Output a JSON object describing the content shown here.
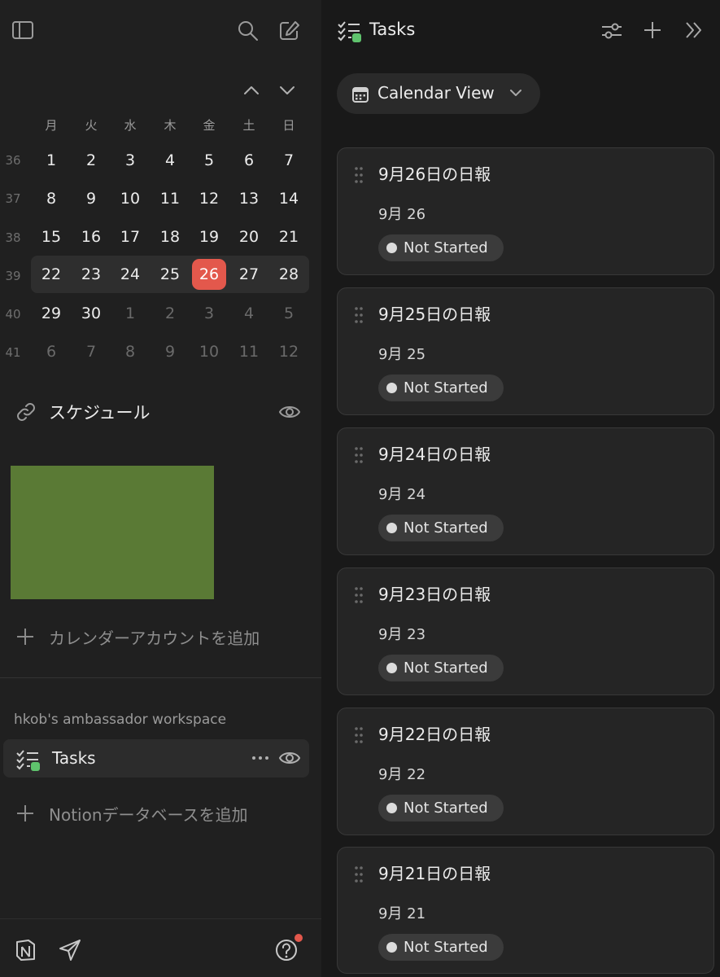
{
  "calendar": {
    "weekdays": [
      "月",
      "火",
      "水",
      "木",
      "金",
      "土",
      "日"
    ],
    "weeks": [
      {
        "num": "36",
        "days": [
          "1",
          "2",
          "3",
          "4",
          "5",
          "6",
          "7"
        ]
      },
      {
        "num": "37",
        "days": [
          "8",
          "9",
          "10",
          "11",
          "12",
          "13",
          "14"
        ]
      },
      {
        "num": "38",
        "days": [
          "15",
          "16",
          "17",
          "18",
          "19",
          "20",
          "21"
        ]
      },
      {
        "num": "39",
        "days": [
          "22",
          "23",
          "24",
          "25",
          "26",
          "27",
          "28"
        ]
      },
      {
        "num": "40",
        "days": [
          "29",
          "30",
          "1",
          "2",
          "3",
          "4",
          "5"
        ]
      },
      {
        "num": "41",
        "days": [
          "6",
          "7",
          "8",
          "9",
          "10",
          "11",
          "12"
        ]
      }
    ],
    "today": "26"
  },
  "schedule": {
    "title": "スケジュール",
    "swatch_color": "#5a7a35",
    "add_calendar_label": "カレンダーアカウントを追加"
  },
  "workspace": {
    "name": "hkob's ambassador workspace",
    "db_item_label": "Tasks",
    "add_db_label": "Notionデータベースを追加"
  },
  "header": {
    "title": "Tasks",
    "view_label": "Calendar View"
  },
  "tasks": [
    {
      "title": "9月26日の日報",
      "date": "9月 26",
      "status": "Not Started"
    },
    {
      "title": "9月25日の日報",
      "date": "9月 25",
      "status": "Not Started"
    },
    {
      "title": "9月24日の日報",
      "date": "9月 24",
      "status": "Not Started"
    },
    {
      "title": "9月23日の日報",
      "date": "9月 23",
      "status": "Not Started"
    },
    {
      "title": "9月22日の日報",
      "date": "9月 22",
      "status": "Not Started"
    },
    {
      "title": "9月21日の日報",
      "date": "9月 21",
      "status": "Not Started"
    }
  ],
  "colors": {
    "today": "#e3584c",
    "tasks_icon_accent": "#5fc36d",
    "notification_dot": "#e3584c"
  }
}
